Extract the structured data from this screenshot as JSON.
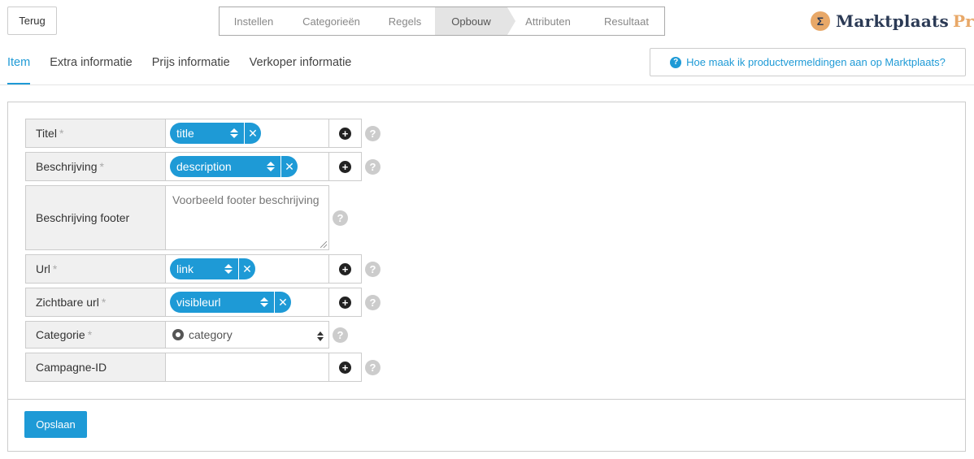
{
  "header": {
    "back_label": "Terug",
    "steps": [
      "Instellen",
      "Categorieën",
      "Regels",
      "Opbouw",
      "Attributen",
      "Resultaat"
    ],
    "active_step": "Opbouw",
    "logo_main": "Marktplaats",
    "logo_pro": "Pro"
  },
  "tabs": [
    "Item",
    "Extra informatie",
    "Prijs informatie",
    "Verkoper informatie"
  ],
  "active_tab": "Item",
  "help_link": "Hoe maak ik productvermeldingen aan op Marktplaats?",
  "form": {
    "titel": {
      "label": "Titel",
      "required": "*",
      "value": "title"
    },
    "beschrijving": {
      "label": "Beschrijving",
      "required": "*",
      "value": "description"
    },
    "beschrijving_footer": {
      "label": "Beschrijving footer",
      "placeholder": "Voorbeeld footer beschrijving"
    },
    "url": {
      "label": "Url",
      "required": "*",
      "value": "link"
    },
    "zichtbare_url": {
      "label": "Zichtbare url",
      "required": "*",
      "value": "visibleurl"
    },
    "categorie": {
      "label": "Categorie",
      "required": "*",
      "value": "category"
    },
    "campagne_id": {
      "label": "Campagne-ID",
      "value": ""
    }
  },
  "save_label": "Opslaan",
  "icons": {
    "plus": "plus-circle-icon",
    "help": "question-circle-icon",
    "remove": "close-icon",
    "sort": "sort-icon",
    "gear": "gear-icon"
  },
  "colors": {
    "accent": "#1e9ad6",
    "brand_orange": "#e8a868",
    "brand_navy": "#2b3a55"
  }
}
